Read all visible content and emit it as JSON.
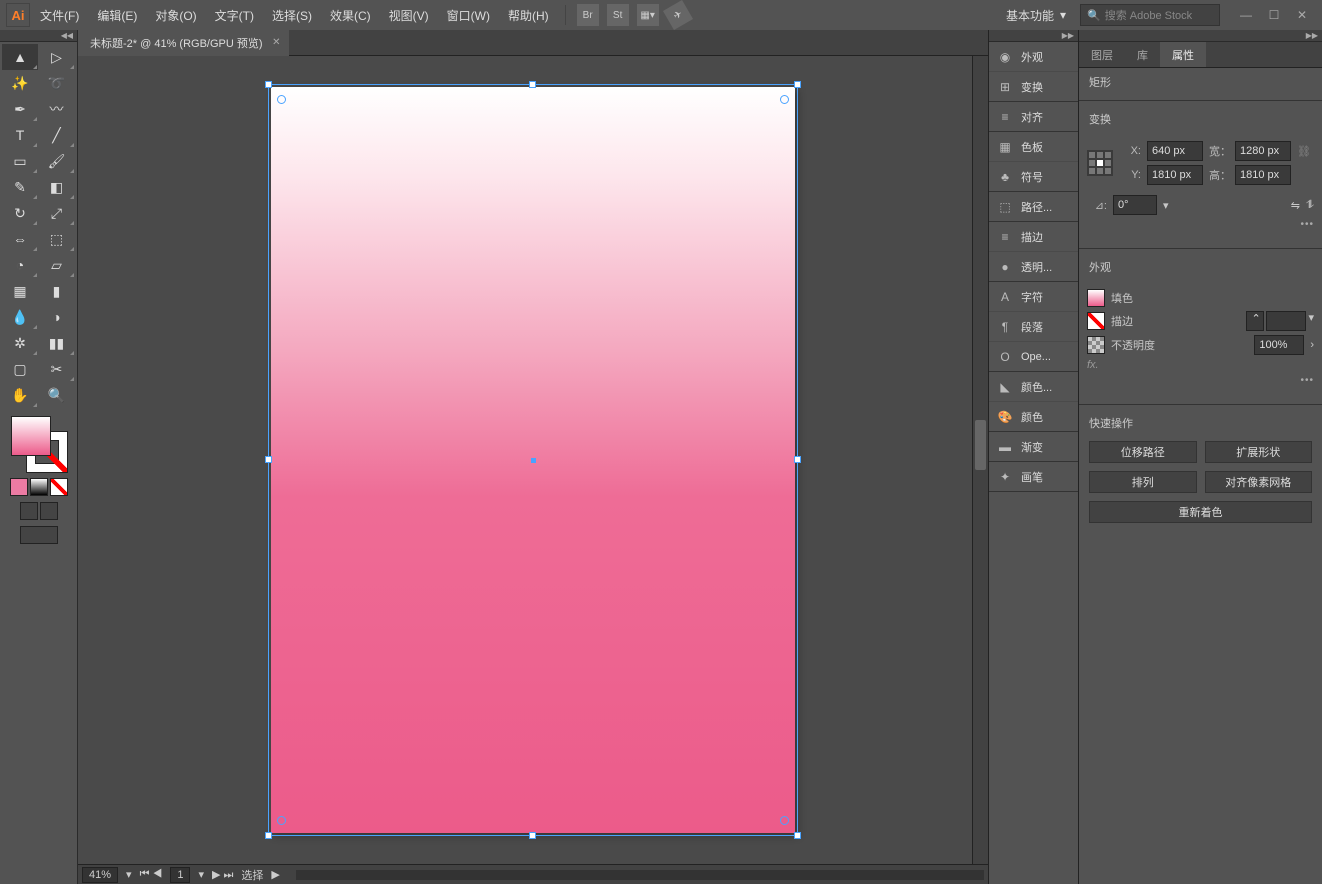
{
  "app": {
    "logo": "Ai"
  },
  "menu": [
    "文件(F)",
    "编辑(E)",
    "对象(O)",
    "文字(T)",
    "选择(S)",
    "效果(C)",
    "视图(V)",
    "窗口(W)",
    "帮助(H)"
  ],
  "topbar_icons": {
    "br": "Br",
    "st": "St"
  },
  "workspace": {
    "label": "基本功能"
  },
  "search": {
    "placeholder": "搜索 Adobe Stock"
  },
  "tab": {
    "title": "未标题-2* @ 41% (RGB/GPU 预览)"
  },
  "statusbar": {
    "zoom": "41%",
    "page": "1",
    "mode": "选择"
  },
  "dock": [
    {
      "icon": "◉",
      "label": "外观"
    },
    {
      "icon": "⊞",
      "label": "变换"
    },
    {
      "icon": "≡",
      "label": "对齐"
    },
    {
      "icon": "▦",
      "label": "色板"
    },
    {
      "icon": "♣",
      "label": "符号"
    },
    {
      "icon": "⬚",
      "label": "路径..."
    },
    {
      "icon": "≡",
      "label": "描边"
    },
    {
      "icon": "●",
      "label": "透明..."
    },
    {
      "icon": "A",
      "label": "字符"
    },
    {
      "icon": "¶",
      "label": "段落"
    },
    {
      "icon": "O",
      "label": "Ope..."
    },
    {
      "icon": "◣",
      "label": "颜色..."
    },
    {
      "icon": "🎨",
      "label": "颜色"
    },
    {
      "icon": "▬",
      "label": "渐变"
    },
    {
      "icon": "✦",
      "label": "画笔"
    }
  ],
  "panel_tabs": [
    "图层",
    "库",
    "属性"
  ],
  "properties": {
    "shape_type": "矩形",
    "section_transform": "变换",
    "x_label": "X:",
    "x": "640 px",
    "w_label": "宽：",
    "w": "1280 px",
    "y_label": "Y:",
    "y": "1810 px",
    "h_label": "高：",
    "h": "1810 px",
    "angle_label": "⊿:",
    "angle": "0°",
    "section_appearance": "外观",
    "fill_label": "填色",
    "stroke_label": "描边",
    "opacity_label": "不透明度",
    "opacity": "100%",
    "fx_label": "fx.",
    "section_quick": "快速操作",
    "btn_offset": "位移路径",
    "btn_expand": "扩展形状",
    "btn_arrange": "排列",
    "btn_align_px": "对齐像素网格",
    "btn_recolor": "重新着色"
  }
}
